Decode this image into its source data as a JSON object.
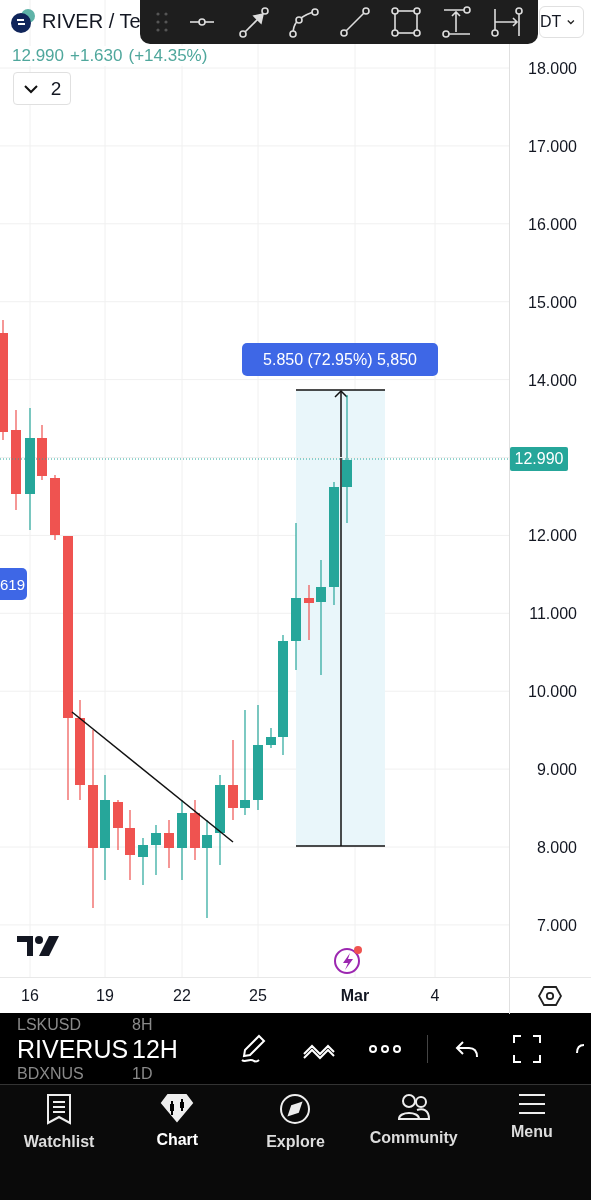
{
  "header": {
    "symbol": "RIVER / Te",
    "quote_currency": "DT",
    "price": "12.990",
    "change": "+1.630",
    "change_pct": "(+14.35%)",
    "indicators_toggle": {
      "count": "2",
      "expanded": false
    }
  },
  "price_axis": {
    "labels": [
      "18.000",
      "17.000",
      "16.000",
      "15.000",
      "14.000",
      "12.000",
      "11.000",
      "10.000",
      "9.000",
      "8.000",
      "7.000"
    ],
    "current_price": "12.990"
  },
  "measure_label": "5.850 (72.95%) 5,850",
  "crosshair_label": "619",
  "time_axis": {
    "labels": [
      {
        "text": "16",
        "bold": false
      },
      {
        "text": "19",
        "bold": false
      },
      {
        "text": "22",
        "bold": false
      },
      {
        "text": "25",
        "bold": false
      },
      {
        "text": "Mar",
        "bold": true
      },
      {
        "text": "4",
        "bold": false
      }
    ]
  },
  "symbol_picker": [
    {
      "symbol": "LSKUSD",
      "interval": "8H",
      "selected": false
    },
    {
      "symbol": "RIVERUS",
      "interval": "12H",
      "selected": true
    },
    {
      "symbol": "BDXNUS",
      "interval": "1D",
      "selected": false
    }
  ],
  "bottom_nav": [
    {
      "label": "Watchlist",
      "selected": false
    },
    {
      "label": "Chart",
      "selected": true
    },
    {
      "label": "Explore",
      "selected": false
    },
    {
      "label": "Community",
      "selected": false
    },
    {
      "label": "Menu",
      "selected": false
    }
  ]
}
